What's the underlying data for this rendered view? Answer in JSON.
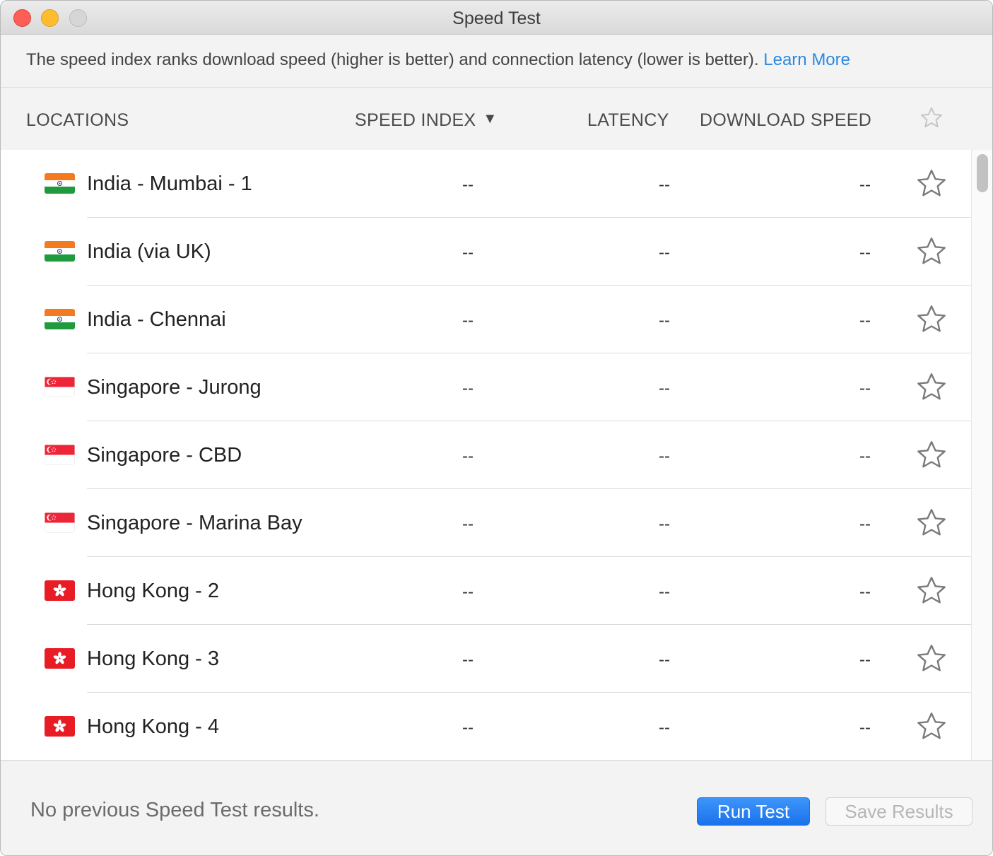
{
  "window": {
    "title": "Speed Test"
  },
  "info": {
    "text": "The speed index ranks download speed (higher is better) and connection latency (lower is better).",
    "link": "Learn More",
    "link_color": "#2a8ae2"
  },
  "columns": {
    "locations": "LOCATIONS",
    "speed_index": "SPEED INDEX",
    "sort_indicator": "▼",
    "latency": "LATENCY",
    "download_speed": "DOWNLOAD SPEED",
    "favorite_icon": "star-outline-icon"
  },
  "rows": [
    {
      "flag": "india",
      "name": "India - Mumbai - 1",
      "speed_index": "--",
      "latency": "--",
      "download": "--"
    },
    {
      "flag": "india",
      "name": "India (via UK)",
      "speed_index": "--",
      "latency": "--",
      "download": "--"
    },
    {
      "flag": "india",
      "name": "India - Chennai",
      "speed_index": "--",
      "latency": "--",
      "download": "--"
    },
    {
      "flag": "singapore",
      "name": "Singapore - Jurong",
      "speed_index": "--",
      "latency": "--",
      "download": "--"
    },
    {
      "flag": "singapore",
      "name": "Singapore - CBD",
      "speed_index": "--",
      "latency": "--",
      "download": "--"
    },
    {
      "flag": "singapore",
      "name": "Singapore - Marina Bay",
      "speed_index": "--",
      "latency": "--",
      "download": "--"
    },
    {
      "flag": "hong-kong",
      "name": "Hong Kong - 2",
      "speed_index": "--",
      "latency": "--",
      "download": "--"
    },
    {
      "flag": "hong-kong",
      "name": "Hong Kong - 3",
      "speed_index": "--",
      "latency": "--",
      "download": "--"
    },
    {
      "flag": "hong-kong",
      "name": "Hong Kong - 4",
      "speed_index": "--",
      "latency": "--",
      "download": "--"
    }
  ],
  "footer": {
    "status": "No previous Speed Test results.",
    "run_button": "Run Test",
    "save_button": "Save Results",
    "run_button_color": "#1a72ec"
  }
}
